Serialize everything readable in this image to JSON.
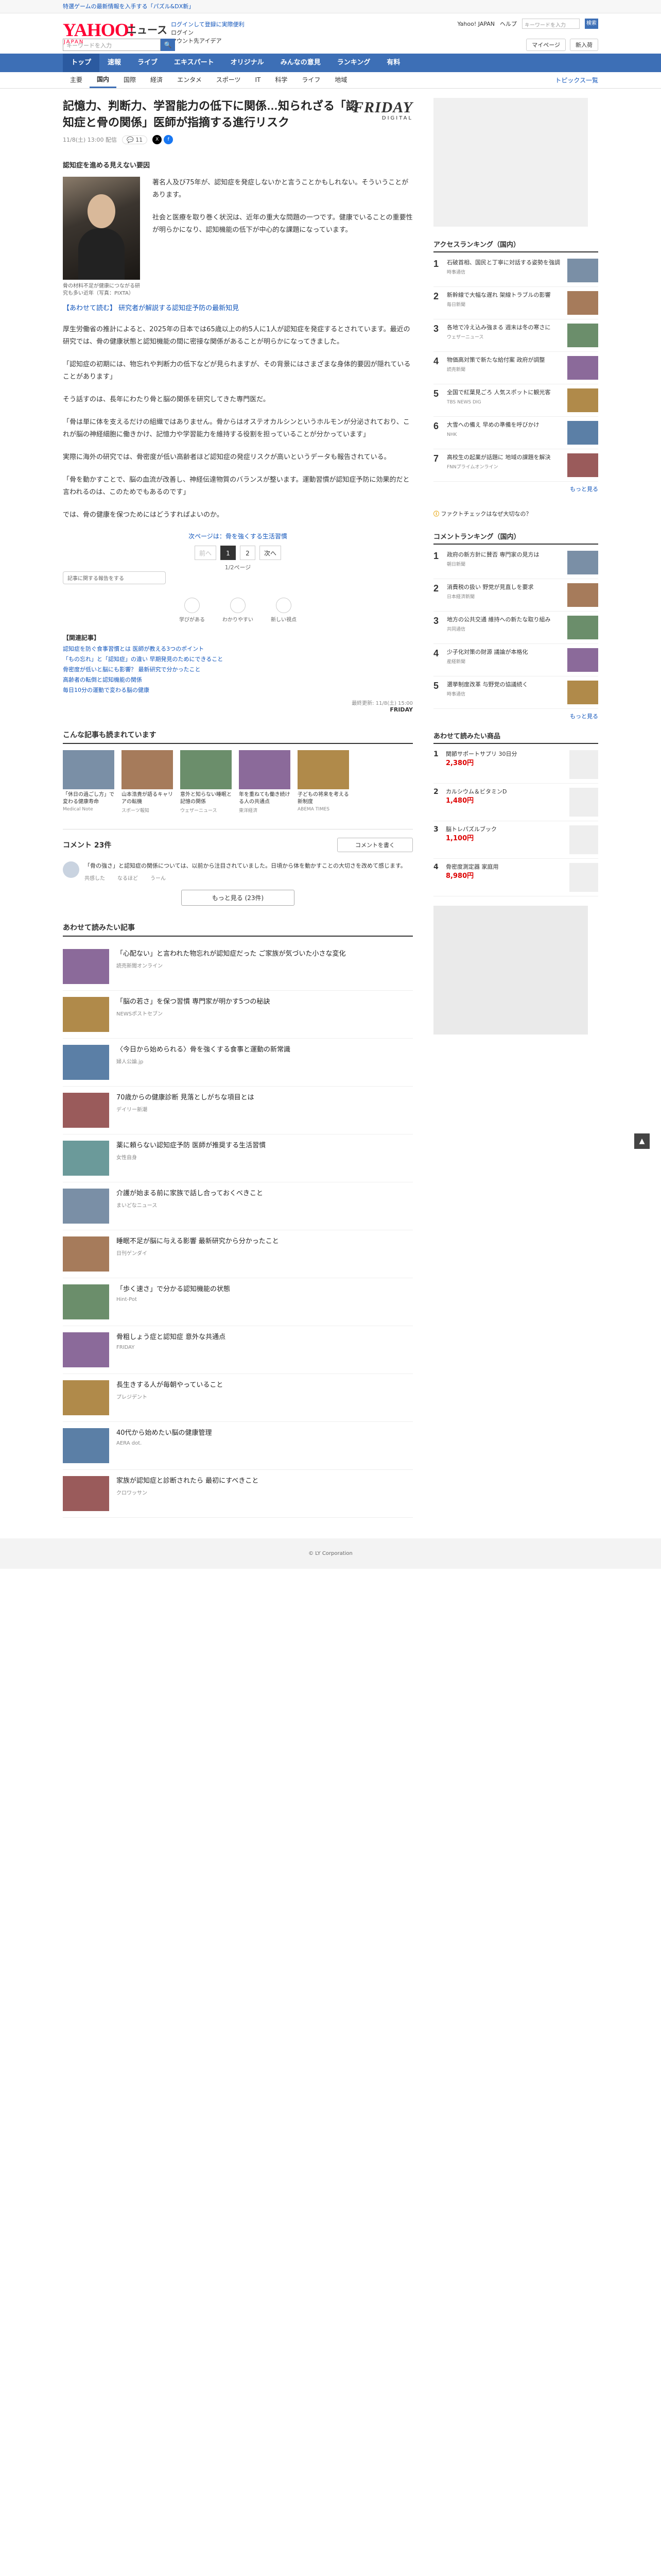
{
  "promo": {
    "text": "特選ゲームの最新情報を入手する「パズル&DX新」"
  },
  "header": {
    "logo_main": "YAHOO!",
    "logo_sub": "JAPAN",
    "brand": "ニュース",
    "links": [
      "ログインして登録に実際便利",
      "ログイン",
      "マウント先アイデア"
    ],
    "top_links": [
      "Yahoo! JAPAN",
      "ヘルプ"
    ],
    "top_search_placeholder": "キーワードを入力",
    "top_search_button": "検索",
    "search_placeholder": "キーワードを入力",
    "search_button": "🔍",
    "right_pills": [
      "マイページ",
      "新入荷"
    ]
  },
  "nav": [
    "トップ",
    "速報",
    "ライブ",
    "エキスパート",
    "オリジナル",
    "みんなの意見",
    "ランキング",
    "有料"
  ],
  "subnav": {
    "items": [
      "主要",
      "国内",
      "国際",
      "経済",
      "エンタメ",
      "スポーツ",
      "IT",
      "科学",
      "ライフ",
      "地域"
    ],
    "active": 1,
    "topics": "トピックス一覧"
  },
  "article": {
    "title": "記憶力、判断力、学習能力の低下に関係…知られざる「認知症と骨の関係」医師が指摘する進行リスク",
    "timestamp": "11/8(土) 13:00 配信",
    "reactions": "リアクション",
    "comment_count": "11",
    "source_brand": "FRIDAY",
    "source_sub": "DIGITAL",
    "kicker": "認知症を進める見えない要因",
    "photo_caption": "骨の材料不足が健康につながる研究も多い近年（写真：PIXTA）",
    "paragraphs": [
      "著名人及び75年が、認知症を発症しないかと言うことかもしれない。そういうことがあります。",
      "社会と医療を取り巻く状況は、近年の重大な問題の一つです。健康でいることの重要性が明らかになり、認知機能の低下が中心的な課題になっています。",
      "【あわせて読む】 研究者が解説する認知症予防の最新知見"
    ],
    "body": [
      "厚生労働省の推計によると、2025年の日本では65歳以上の約5人に1人が認知症を発症するとされています。最近の研究では、骨の健康状態と認知機能の間に密接な関係があることが明らかになってきました。",
      "「認知症の初期には、物忘れや判断力の低下などが見られますが、その背景にはさまざまな身体的要因が隠れていることがあります」",
      "そう話すのは、長年にわたり骨と脳の関係を研究してきた専門医だ。",
      "「骨は単に体を支えるだけの組織ではありません。骨からはオステオカルシンというホルモンが分泌されており、これが脳の神経細胞に働きかけ、記憶力や学習能力を維持する役割を担っていることが分かっています」",
      "実際に海外の研究では、骨密度が低い高齢者ほど認知症の発症リスクが高いというデータも報告されている。",
      "「骨を動かすことで、脳の血流が改善し、神経伝達物質のバランスが整います。運動習慣が認知症予防に効果的だと言われるのは、このためでもあるのです」",
      "では、骨の健康を保つためにはどうすればよいのか。"
    ],
    "continue_link": "次ページは：骨を強くする生活習慣",
    "pager": {
      "prev": "前へ",
      "pages": [
        "1",
        "2"
      ],
      "next": "次へ",
      "count": "1/2ページ"
    },
    "react_prompt": "記事に関する報告をする",
    "react_buttons": [
      "学びがある",
      "わかりやすい",
      "新しい視点"
    ],
    "related_title": "【関連記事】",
    "related": [
      "認知症を防ぐ食事習慣とは 医師が教える3つのポイント",
      "「もの忘れ」と「認知症」の違い 早期発見のためにできること",
      "骨密度が低いと脳にも影響？ 最新研究で分かったこと",
      "高齢者の転倒と認知機能の関係",
      "毎日10分の運動で変わる脳の健康"
    ],
    "copyright_line": "最終更新: 11/8(土) 15:00",
    "copyright_brand": "FRIDAY"
  },
  "recommend": {
    "title": "こんな記事も読まれています",
    "items": [
      {
        "title": "「休日の過ごし方」で変わる健康寿命",
        "source": "Medical Note"
      },
      {
        "title": "山本浩貴が語るキャリアの転機",
        "source": "スポーツ報知"
      },
      {
        "title": "意外と知らない睡眠と記憶の関係",
        "source": "ウェザーニュース"
      },
      {
        "title": "年を重ねても働き続ける人の共通点",
        "source": "東洋経済"
      },
      {
        "title": "子どもの将来を考える新制度",
        "source": "ABEMA TIMES"
      }
    ]
  },
  "comments": {
    "title": "コメント",
    "count": "23件",
    "write_button": "コメントを書く",
    "body": "「骨の強さ」と認知症の関係については、以前から注目されていました。日頃から体を動かすことの大切さを改めて感じます。",
    "actions": [
      "共感した",
      "なるほど",
      "うーん"
    ],
    "more": "もっと見る (23件)"
  },
  "read_more": {
    "title": "あわせて読みたい記事",
    "items": [
      {
        "title": "「心配ない」と言われた物忘れが認知症だった ご家族が気づいた小さな変化",
        "source": "読売新聞オンライン"
      },
      {
        "title": "「脳の若さ」を保つ習慣 専門家が明かす5つの秘訣",
        "source": "NEWSポストセブン"
      },
      {
        "title": "〈今日から始められる〉骨を強くする食事と運動の新常識",
        "source": "婦人公論.jp"
      },
      {
        "title": "70歳からの健康診断 見落としがちな項目とは",
        "source": "デイリー新潮"
      },
      {
        "title": "薬に頼らない認知症予防 医師が推奨する生活習慣",
        "source": "女性自身"
      },
      {
        "title": "介護が始まる前に家族で話し合っておくべきこと",
        "source": "まいどなニュース"
      },
      {
        "title": "睡眠不足が脳に与える影響 最新研究から分かったこと",
        "source": "日刊ゲンダイ"
      },
      {
        "title": "「歩く速さ」で分かる認知機能の状態",
        "source": "Hint-Pot"
      },
      {
        "title": "骨粗しょう症と認知症 意外な共通点",
        "source": "FRIDAY"
      },
      {
        "title": "長生きする人が毎朝やっていること",
        "source": "プレジデント"
      },
      {
        "title": "40代から始めたい脳の健康管理",
        "source": "AERA dot."
      },
      {
        "title": "家族が認知症と診断されたら 最初にすべきこと",
        "source": "クロワッサン"
      }
    ]
  },
  "sidebar": {
    "access_title": "アクセスランキング（国内）",
    "access": [
      {
        "title": "石破首相、国民と丁寧に対話する姿勢を強調",
        "source": "時事通信"
      },
      {
        "title": "新幹線で大幅な遅れ 架線トラブルの影響",
        "source": "毎日新聞"
      },
      {
        "title": "各地で冷え込み強まる 週末は冬の寒さに",
        "source": "ウェザーニュース"
      },
      {
        "title": "物価高対策で新たな給付案 政府が調整",
        "source": "読売新聞"
      },
      {
        "title": "全国で紅葉見ごろ 人気スポットに観光客",
        "source": "TBS NEWS DIG"
      },
      {
        "title": "大雪への備え 早めの準備を呼びかけ",
        "source": "NHK"
      },
      {
        "title": "高校生の起業が話題に 地域の課題を解決",
        "source": "FNNプライムオンライン"
      }
    ],
    "more": "もっと見る",
    "fact": "ファクトチェックはなぜ大切なの？",
    "comment_title": "コメントランキング（国内）",
    "comment_rank": [
      {
        "title": "政府の新方針に賛否 専門家の見方は",
        "source": "朝日新聞"
      },
      {
        "title": "消費税の扱い 野党が見直しを要求",
        "source": "日本経済新聞"
      },
      {
        "title": "地方の公共交通 維持への新たな取り組み",
        "source": "共同通信"
      },
      {
        "title": "少子化対策の財源 議論が本格化",
        "source": "産経新聞"
      },
      {
        "title": "選挙制度改革 与野党の協議続く",
        "source": "時事通信"
      }
    ],
    "shop_title": "あわせて読みたい商品",
    "shop": [
      {
        "title": "関節サポートサプリ 30日分",
        "price": "2,380円"
      },
      {
        "title": "カルシウム＆ビタミンD",
        "price": "1,480円"
      },
      {
        "title": "脳トレパズルブック",
        "price": "1,100円"
      },
      {
        "title": "骨密度測定器 家庭用",
        "price": "8,980円"
      }
    ]
  },
  "footer": {
    "text": "© LY Corporation"
  }
}
